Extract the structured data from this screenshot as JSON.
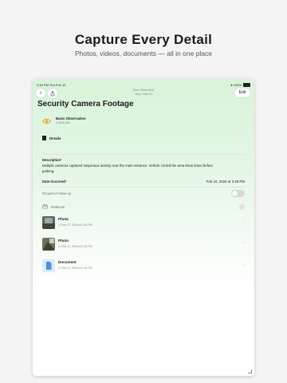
{
  "promo": {
    "headline": "Capture Every Detail",
    "subheadline": "Photos, videos, documents — all in one place"
  },
  "status_bar": {
    "time": "2:34 PM",
    "date": "Thu Feb 12",
    "battery": "100%"
  },
  "nav": {
    "back_icon": "chevron-left-icon",
    "share_icon": "share-icon",
    "center_title": "Basic Observation",
    "center_subtitle": "Supp-Total-On",
    "edit_label": "Edit"
  },
  "record": {
    "title": "Security Camera Footage",
    "type_name": "Basic Observation",
    "type_id": "# 2026-001",
    "type_icon": "eye-icon"
  },
  "details_label": "Details",
  "description": {
    "label": "Description",
    "asterisk": "*",
    "text": "Multiple cameras captured suspicious activity near the main entrance. Vehicle circled the area three times before parking."
  },
  "date_occurred": {
    "label": "Date Occurred",
    "asterisk": "*",
    "value": "Feb 10, 2026 at 2:26 PM"
  },
  "follow_up": {
    "label": "Requires Follow-up",
    "enabled": false
  },
  "evidence": {
    "label": "Evidence",
    "items": [
      {
        "type": "Photo",
        "date": "Feb 12, 2026 at 2:32 PM",
        "icon": "photo-thumbnail"
      },
      {
        "type": "Photo",
        "date": "Feb 12, 2026 at 2:32 PM",
        "icon": "photo-thumbnail"
      },
      {
        "type": "Document",
        "date": "Feb 12, 2026 at 2:34 PM",
        "icon": "document-icon"
      }
    ]
  },
  "colors": {
    "header_green": "#d8f4da",
    "accent_orange": "#e6a431",
    "document_blue": "#4a8fdd"
  }
}
